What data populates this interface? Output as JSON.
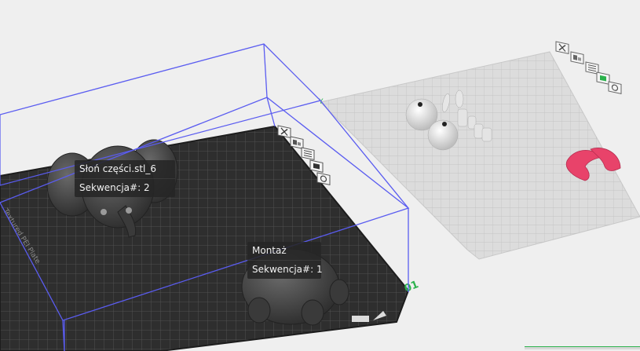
{
  "objects": [
    {
      "name": "Słoń części.stl_6",
      "sequence": "Sekwencja#: 2"
    },
    {
      "name": "Montaż",
      "sequence": "Sekwencja#: 1"
    }
  ],
  "plate": {
    "index_label": "01",
    "side_text": "Textured PEI Plate"
  },
  "colors": {
    "accent": "#2bb24c",
    "bbox": "#5a5cf0",
    "plate_dark": "#2e2e2e",
    "plate_light": "#d6d6d6",
    "object_pink": "#e8436a"
  },
  "plate_tool_icons": [
    "close-icon",
    "arrange-icon",
    "orient-icon",
    "lock-icon",
    "settings-icon"
  ]
}
